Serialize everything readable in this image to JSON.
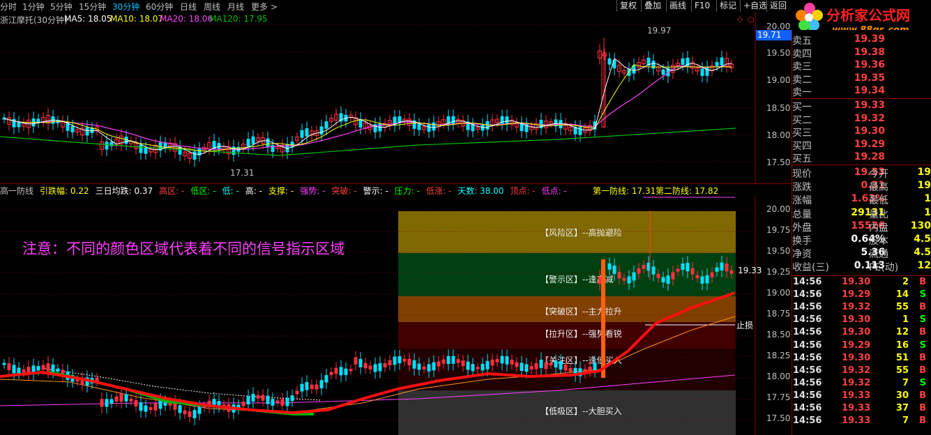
{
  "topbar": {
    "periods": [
      "分时",
      "1分钟",
      "5分钟",
      "15分钟",
      "30分钟",
      "60分钟",
      "日线",
      "周线",
      "月线",
      "更多 >"
    ],
    "active_period": "30分钟",
    "buttons": [
      "复权",
      "叠加",
      "画线",
      "F10",
      "标记",
      "+自选",
      "返回"
    ]
  },
  "logo": {
    "text": "分析家公式网",
    "url": "www.88gs.com"
  },
  "main_panel": {
    "title": "浙江摩托(30分钟)",
    "ma5": "MA5: 18.05",
    "ma10": "MA10: 18.07",
    "ma20": "MA20: 18.06",
    "ma120": "MA120: 17.95",
    "high_label": "19.97",
    "low_label": "17.31",
    "current_price_tag": "19.71",
    "y_ticks": [
      "20.00",
      "19.50",
      "19.00",
      "18.50",
      "18.00",
      "17.50"
    ]
  },
  "indicator_panel": {
    "items": [
      {
        "text": "高一防线",
        "color": "#c0c0c0"
      },
      {
        "text": "引跌幅: 0.22",
        "color": "#ffff00"
      },
      {
        "text": "三日均跌: 0.37",
        "color": "#ffffff"
      },
      {
        "text": "高区: -",
        "color": "#ff4040"
      },
      {
        "text": "低区: -",
        "color": "#00ff00"
      },
      {
        "text": "低: -",
        "color": "#00ffff"
      },
      {
        "text": "高: -",
        "color": "#ffffff"
      },
      {
        "text": "支撑: -",
        "color": "#ffff00"
      },
      {
        "text": "强势: -",
        "color": "#ff40ff"
      },
      {
        "text": "突破: -",
        "color": "#ff4040"
      },
      {
        "text": "警示: -",
        "color": "#ffffff"
      },
      {
        "text": "压力: -",
        "color": "#00ff00"
      },
      {
        "text": "低涨: -",
        "color": "#ff4040"
      },
      {
        "text": "天数: 38.00",
        "color": "#00ffff"
      },
      {
        "text": "顶点: -",
        "color": "#ff4040"
      },
      {
        "text": "低点: -",
        "color": "#ff40ff"
      }
    ],
    "defense1": "第一防线: 17.31",
    "defense2": "第二防线: 17.82",
    "note": "注意：不同的颜色区域代表着不同的信号指示区域",
    "price_tag": "19.33",
    "stop_label": "止损",
    "y_ticks": [
      "20.00",
      "19.75",
      "19.50",
      "19.25",
      "19.00",
      "18.75",
      "18.50",
      "18.25",
      "18.00",
      "17.75",
      "17.50"
    ],
    "zones": [
      {
        "label": "【风险区】--高抛避险",
        "color": "#806800"
      },
      {
        "label": "【警示区】--逢高减",
        "color": "#004010"
      },
      {
        "label": "【突破区】--主力拉升",
        "color": "#804000"
      },
      {
        "label": "【拉升区】--强势看锐",
        "color": "#400000"
      },
      {
        "label": "【关注区】--逢低买入",
        "color": "#200000"
      },
      {
        "label": "【低吸区】--大胆买入",
        "color": "#303030"
      }
    ]
  },
  "quote": {
    "asks": [
      {
        "label": "卖五",
        "price": "19.39",
        "color": "#ff4040"
      },
      {
        "label": "卖四",
        "price": "19.38",
        "color": "#ff4040"
      },
      {
        "label": "卖三",
        "price": "19.36",
        "color": "#ff4040"
      },
      {
        "label": "卖二",
        "price": "19.35",
        "color": "#ff4040"
      },
      {
        "label": "卖一",
        "price": "19.34",
        "color": "#ff4040"
      }
    ],
    "bids": [
      {
        "label": "买一",
        "price": "19.33",
        "color": "#ff4040"
      },
      {
        "label": "买二",
        "price": "19.32",
        "color": "#ff4040"
      },
      {
        "label": "买三",
        "price": "19.30",
        "color": "#ff4040"
      },
      {
        "label": "买四",
        "price": "19.29",
        "color": "#ff4040"
      },
      {
        "label": "买五",
        "price": "19.28",
        "color": "#ff4040"
      }
    ],
    "stats": [
      {
        "l1": "现价",
        "v1": "19.33",
        "c1": "#ff4040",
        "l2": "今开",
        "v2": "19"
      },
      {
        "l1": "涨跌",
        "v1": "0.31",
        "c1": "#ff4040",
        "l2": "最高",
        "v2": "19"
      },
      {
        "l1": "涨幅",
        "v1": "1.63%",
        "c1": "#ff4040",
        "l2": "最低",
        "v2": "1"
      },
      {
        "l1": "总量",
        "v1": "29131",
        "c1": "#ffff00",
        "l2": "量比",
        "v2": "1"
      },
      {
        "l1": "外盘",
        "v1": "15526",
        "c1": "#ff4040",
        "l2": "内盘",
        "v2": "130"
      },
      {
        "l1": "换手",
        "v1": "0.64%",
        "c1": "#ffffff",
        "l2": "股本",
        "v2": "4.5"
      },
      {
        "l1": "净资",
        "v1": "5.36",
        "c1": "#ffffff",
        "l2": "流通",
        "v2": "4.5"
      },
      {
        "l1": "收益(三)",
        "v1": "0.113",
        "c1": "#ffffff",
        "l2": "PE(动)",
        "v2": "12"
      }
    ],
    "ticks": [
      {
        "time": "14:56",
        "price": "19.30",
        "vol": "2",
        "side": "B"
      },
      {
        "time": "14:56",
        "price": "19.29",
        "vol": "14",
        "side": "S"
      },
      {
        "time": "14:56",
        "price": "19.32",
        "vol": "55",
        "side": "B"
      },
      {
        "time": "14:56",
        "price": "19.30",
        "vol": "1",
        "side": "S"
      },
      {
        "time": "14:56",
        "price": "19.30",
        "vol": "12",
        "side": "B"
      },
      {
        "time": "14:56",
        "price": "19.29",
        "vol": "16",
        "side": "S"
      },
      {
        "time": "14:56",
        "price": "19.30",
        "vol": "51",
        "side": "B"
      },
      {
        "time": "14:56",
        "price": "19.32",
        "vol": "55",
        "side": "B"
      },
      {
        "time": "14:56",
        "price": "19.32",
        "vol": "7",
        "side": "S"
      },
      {
        "time": "14:56",
        "price": "19.33",
        "vol": "30",
        "side": "B"
      },
      {
        "time": "14:56",
        "price": "19.33",
        "vol": "37",
        "side": "B"
      },
      {
        "time": "14:56",
        "price": "19.33",
        "vol": "7",
        "side": "B"
      }
    ]
  },
  "colors": {
    "up": "#ff3040",
    "down": "#00e0ff",
    "ma5": "#ffffff",
    "ma10": "#ffff00",
    "ma20": "#ff40ff",
    "ma120": "#00c000"
  }
}
